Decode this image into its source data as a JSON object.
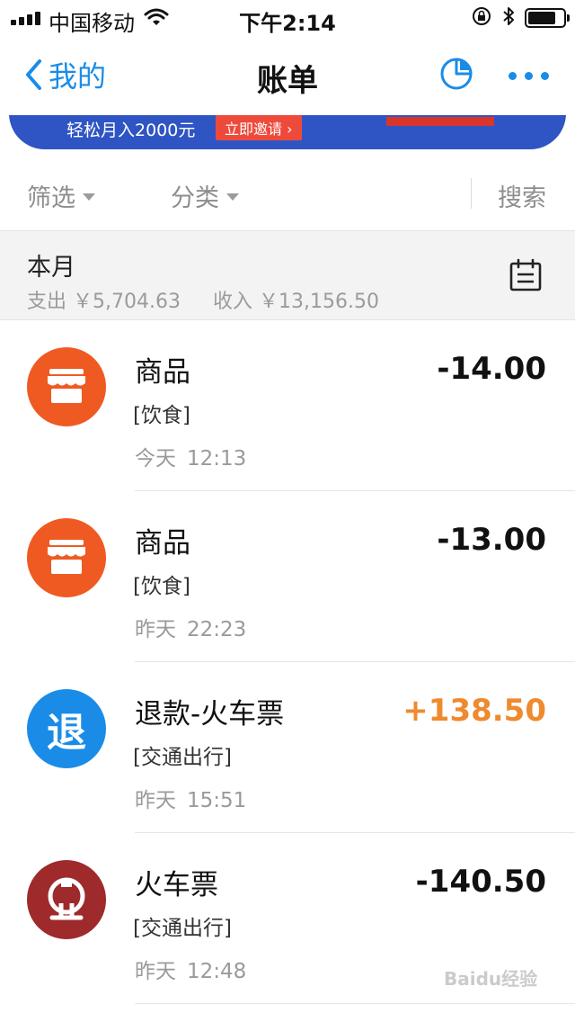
{
  "status_bar": {
    "carrier": "中国移动",
    "time": "下午2:14"
  },
  "nav": {
    "back_label": "我的",
    "title": "账单",
    "accent_color": "#1a8ce8"
  },
  "banner": {
    "text": "轻松月入2000元",
    "button_label": "立即邀请 ›"
  },
  "filter": {
    "filter_label": "筛选",
    "category_label": "分类",
    "search_label": "搜索"
  },
  "month": {
    "title": "本月",
    "expense_label": "支出",
    "expense_value": "￥5,704.63",
    "income_label": "收入",
    "income_value": "￥13,156.50"
  },
  "transactions": [
    {
      "title": "商品",
      "category": "[饮食]",
      "day": "今天",
      "time": "12:13",
      "amount": "-14.00",
      "icon": "shop-icon",
      "icon_color": "#ef5a22"
    },
    {
      "title": "商品",
      "category": "[饮食]",
      "day": "昨天",
      "time": "22:23",
      "amount": "-13.00",
      "icon": "shop-icon",
      "icon_color": "#ef5a22"
    },
    {
      "title": "退款-火车票",
      "category": "[交通出行]",
      "day": "昨天",
      "time": "15:51",
      "amount": "+138.50",
      "icon": "refund-icon",
      "icon_glyph": "退",
      "icon_color": "#1a8ce8"
    },
    {
      "title": "火车票",
      "category": "[交通出行]",
      "day": "昨天",
      "time": "12:48",
      "amount": "-140.50",
      "icon": "railway-icon",
      "icon_color": "#9e2a2b"
    }
  ],
  "watermark": "Baidu经验"
}
